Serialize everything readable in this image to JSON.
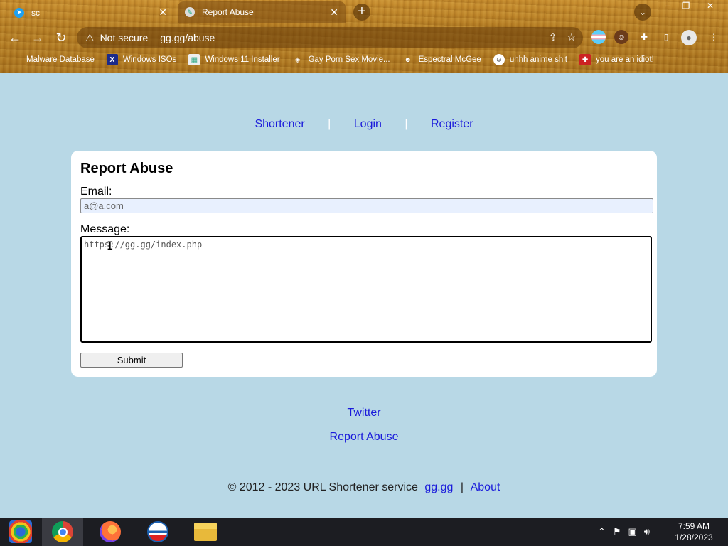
{
  "browser": {
    "tabs": [
      {
        "title": "sc",
        "close": "✕"
      },
      {
        "title": "Report Abuse",
        "close": "✕"
      }
    ],
    "new_tab": "+",
    "window_controls": [
      "─",
      "❐",
      "✕"
    ],
    "security_label": "Not secure",
    "url": "gg.gg/abuse",
    "bookmarks": [
      "Malware Database",
      "Windows ISOs",
      "Windows 11 Installer",
      "Gay Porn Sex Movie...",
      "Espectral McGee",
      "uhhh anime shit",
      "you are an idiot!"
    ]
  },
  "nav": {
    "shortener": "Shortener",
    "login": "Login",
    "register": "Register",
    "separator": "|"
  },
  "form": {
    "title": "Report Abuse",
    "email_label": "Email:",
    "email_value": "a@a.com",
    "message_label": "Message:",
    "message_value": "https://gg.gg/index.php",
    "submit_label": "Submit"
  },
  "footer": {
    "twitter": "Twitter",
    "report_abuse": "Report Abuse",
    "copyright": "© 2012 - 2023 URL Shortener service",
    "site": "gg.gg",
    "separator": "|",
    "about": "About"
  },
  "taskbar": {
    "time": "7:59 AM",
    "date": "1/28/2023"
  },
  "icons": [
    "back-arrow-icon",
    "forward-arrow-icon",
    "reload-icon",
    "warning-icon",
    "share-icon",
    "star-icon",
    "extensions-icon",
    "sidepanel-icon",
    "profile-icon"
  ]
}
